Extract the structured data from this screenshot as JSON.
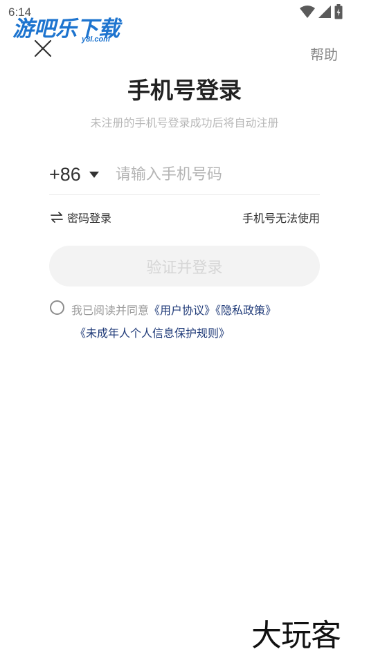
{
  "status_bar": {
    "time": "6:14",
    "icons": [
      "wifi-icon",
      "signal-icon",
      "battery-icon"
    ]
  },
  "watermark_top": {
    "cn": "游吧乐下载",
    "en": "y8l.com",
    "color": "#1d74cf"
  },
  "header": {
    "close_icon": "close-icon",
    "help_label": "帮助"
  },
  "login": {
    "title": "手机号登录",
    "subtitle": "未注册的手机号登录成功后将自动注册",
    "country_code": "+86",
    "phone_placeholder": "请输入手机号码",
    "phone_value": "",
    "password_login_label": "密码登录",
    "phone_unusable_label": "手机号无法使用",
    "submit_label": "验证并登录"
  },
  "agreement": {
    "checked": false,
    "prefix": "我已阅读并同意",
    "user_agreement": "《用户协议》",
    "privacy_policy": "《隐私政策》",
    "minor_policy": "《未成年人个人信息保护规则》",
    "link_color": "#1f3a78"
  },
  "watermark_bottom": {
    "text": "大玩客"
  }
}
